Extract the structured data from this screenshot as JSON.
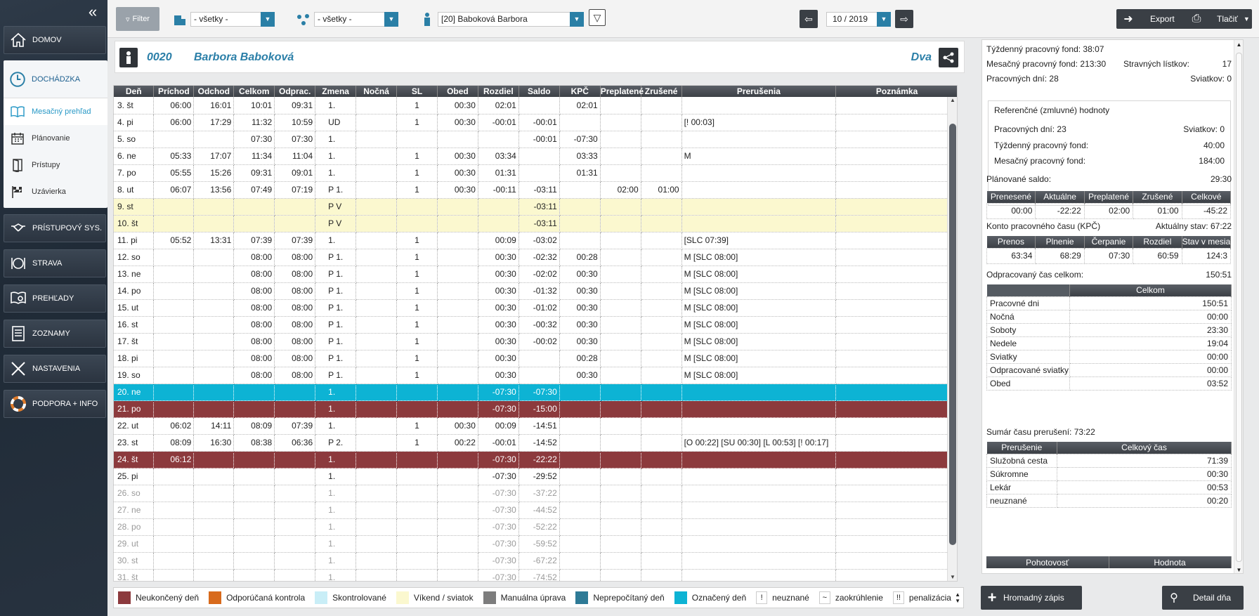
{
  "sidebar": {
    "collapse_icon": "double-chevron-left-icon",
    "items": [
      {
        "label": "DOMOV",
        "icon": "home-icon"
      },
      {
        "label": "DOCHÁDZKA",
        "icon": "clock-icon"
      },
      {
        "label": "PRÍSTUPOVÝ SYS.",
        "icon": "handshake-icon"
      },
      {
        "label": "STRAVA",
        "icon": "plate-icon"
      },
      {
        "label": "PREHĽADY",
        "icon": "report-icon"
      },
      {
        "label": "ZOZNAMY",
        "icon": "list-icon"
      },
      {
        "label": "NASTAVENIA",
        "icon": "tools-icon"
      },
      {
        "label": "PODPORA + INFO",
        "icon": "lifebuoy-icon"
      }
    ],
    "sub_items": [
      {
        "label": "Mesačný prehľad",
        "icon": "book-icon"
      },
      {
        "label": "Plánovanie",
        "icon": "calendar-icon"
      },
      {
        "label": "Prístupy",
        "icon": "door-icon"
      },
      {
        "label": "Uzávierka",
        "icon": "checkered-flag-icon"
      }
    ]
  },
  "toolbar": {
    "filter_label": "Filter",
    "org_select": "- všetky -",
    "group_select": "- všetky -",
    "person_select": "[20] Baboková Barbora",
    "period": "10 / 2019",
    "export_label": "Export",
    "print_label": "Tlačiť"
  },
  "person": {
    "code": "0020",
    "name": "Barbora Baboková",
    "group": "Dva"
  },
  "table": {
    "columns": [
      "Deň",
      "Príchod",
      "Odchod",
      "Celkom",
      "Odprac.",
      "Zmena",
      "Nočná",
      "SL",
      "Obed",
      "Rozdiel",
      "Saldo",
      "KPČ",
      "Preplatené",
      "Zrušené",
      "Prerušenia",
      "Poznámka"
    ],
    "rows": [
      {
        "t": "",
        "c": [
          "3. št",
          "06:00",
          "16:01",
          "10:01",
          "09:31",
          "1.",
          "",
          "1",
          "00:30",
          "02:01",
          "",
          "02:01",
          "",
          "",
          "",
          ""
        ]
      },
      {
        "t": "",
        "c": [
          "4. pi",
          "06:00",
          "17:29",
          "11:32",
          "10:59",
          "UD",
          "",
          "1",
          "00:30",
          "-00:01",
          "-00:01",
          "",
          "",
          "",
          "[! 00:03]",
          ""
        ]
      },
      {
        "t": "",
        "c": [
          "5. so",
          "",
          "",
          "07:30",
          "07:30",
          "1.",
          "",
          "",
          "",
          "",
          "-00:01",
          "-07:30",
          "",
          "",
          "",
          ""
        ]
      },
      {
        "t": "",
        "c": [
          "6. ne",
          "05:33",
          "17:07",
          "11:34",
          "11:04",
          "1.",
          "",
          "1",
          "00:30",
          "03:34",
          "",
          "03:33",
          "",
          "",
          "M",
          ""
        ]
      },
      {
        "t": "",
        "c": [
          "7. po",
          "05:55",
          "15:26",
          "09:31",
          "09:01",
          "1.",
          "",
          "1",
          "00:30",
          "01:31",
          "",
          "01:31",
          "",
          "",
          "",
          ""
        ]
      },
      {
        "t": "",
        "c": [
          "8. ut",
          "06:07",
          "13:56",
          "07:49",
          "07:19",
          "P 1.",
          "",
          "1",
          "00:30",
          "-00:11",
          "-03:11",
          "",
          "02:00",
          "01:00",
          "",
          ""
        ]
      },
      {
        "t": "weekend",
        "c": [
          "9. st",
          "",
          "",
          "",
          "",
          "P V",
          "",
          "",
          "",
          "",
          "-03:11",
          "",
          "",
          "",
          "",
          ""
        ]
      },
      {
        "t": "weekend",
        "c": [
          "10. št",
          "",
          "",
          "",
          "",
          "P V",
          "",
          "",
          "",
          "",
          "-03:11",
          "",
          "",
          "",
          "",
          ""
        ]
      },
      {
        "t": "",
        "c": [
          "11. pi",
          "05:52",
          "13:31",
          "07:39",
          "07:39",
          "1.",
          "",
          "1",
          "",
          "00:09",
          "-03:02",
          "",
          "",
          "",
          "[SLC 07:39]",
          ""
        ]
      },
      {
        "t": "",
        "c": [
          "12. so",
          "",
          "",
          "08:00",
          "08:00",
          "P 1.",
          "",
          "1",
          "",
          "00:30",
          "-02:32",
          "00:28",
          "",
          "",
          "M [SLC 08:00]",
          ""
        ]
      },
      {
        "t": "",
        "c": [
          "13. ne",
          "",
          "",
          "08:00",
          "08:00",
          "P 1.",
          "",
          "1",
          "",
          "00:30",
          "-02:02",
          "00:30",
          "",
          "",
          "M [SLC 08:00]",
          ""
        ]
      },
      {
        "t": "",
        "c": [
          "14. po",
          "",
          "",
          "08:00",
          "08:00",
          "P 1.",
          "",
          "1",
          "",
          "00:30",
          "-01:32",
          "00:30",
          "",
          "",
          "M [SLC 08:00]",
          ""
        ]
      },
      {
        "t": "",
        "c": [
          "15. ut",
          "",
          "",
          "08:00",
          "08:00",
          "P 1.",
          "",
          "1",
          "",
          "00:30",
          "-01:02",
          "00:30",
          "",
          "",
          "M [SLC 08:00]",
          ""
        ]
      },
      {
        "t": "",
        "c": [
          "16. st",
          "",
          "",
          "08:00",
          "08:00",
          "P 1.",
          "",
          "1",
          "",
          "00:30",
          "-00:32",
          "00:30",
          "",
          "",
          "M [SLC 08:00]",
          ""
        ]
      },
      {
        "t": "",
        "c": [
          "17. št",
          "",
          "",
          "08:00",
          "08:00",
          "P 1.",
          "",
          "1",
          "",
          "00:30",
          "-00:02",
          "00:30",
          "",
          "",
          "M [SLC 08:00]",
          ""
        ]
      },
      {
        "t": "",
        "c": [
          "18. pi",
          "",
          "",
          "08:00",
          "08:00",
          "P 1.",
          "",
          "1",
          "",
          "00:30",
          "",
          "00:28",
          "",
          "",
          "M [SLC 08:00]",
          ""
        ]
      },
      {
        "t": "",
        "c": [
          "19. so",
          "",
          "",
          "08:00",
          "08:00",
          "P 1.",
          "",
          "1",
          "",
          "00:30",
          "",
          "00:30",
          "",
          "",
          "M [SLC 08:00]",
          ""
        ]
      },
      {
        "t": "marked",
        "c": [
          "20. ne",
          "",
          "",
          "",
          "",
          "1.",
          "",
          "",
          "",
          "-07:30",
          "-07:30",
          "",
          "",
          "",
          "",
          ""
        ]
      },
      {
        "t": "unfinished",
        "c": [
          "21. po",
          "",
          "",
          "",
          "",
          "1.",
          "",
          "",
          "",
          "-07:30",
          "-15:00",
          "",
          "",
          "",
          "",
          ""
        ]
      },
      {
        "t": "",
        "c": [
          "22. ut",
          "06:02",
          "14:11",
          "08:09",
          "07:39",
          "1.",
          "",
          "1",
          "00:30",
          "00:09",
          "-14:51",
          "",
          "",
          "",
          "",
          ""
        ]
      },
      {
        "t": "",
        "c": [
          "23. st",
          "08:09",
          "16:30",
          "08:38",
          "06:36",
          "P 2.",
          "",
          "1",
          "00:22",
          "-00:01",
          "-14:52",
          "",
          "",
          "",
          "[O 00:22] [SU 00:30] [L 00:53] [! 00:17]",
          ""
        ]
      },
      {
        "t": "unfinished",
        "c": [
          "24. št",
          "06:12",
          "",
          "",
          "",
          "1.",
          "",
          "",
          "",
          "-07:30",
          "-22:22",
          "",
          "",
          "",
          "",
          ""
        ]
      },
      {
        "t": "",
        "c": [
          "25. pi",
          "",
          "",
          "",
          "",
          "1.",
          "",
          "",
          "",
          "-07:30",
          "-29:52",
          "",
          "",
          "",
          "",
          ""
        ]
      },
      {
        "t": "future",
        "c": [
          "26. so",
          "",
          "",
          "",
          "",
          "1.",
          "",
          "",
          "",
          "-07:30",
          "-37:22",
          "",
          "",
          "",
          "",
          ""
        ]
      },
      {
        "t": "future",
        "c": [
          "27. ne",
          "",
          "",
          "",
          "",
          "1.",
          "",
          "",
          "",
          "-07:30",
          "-44:52",
          "",
          "",
          "",
          "",
          ""
        ]
      },
      {
        "t": "future",
        "c": [
          "28. po",
          "",
          "",
          "",
          "",
          "1.",
          "",
          "",
          "",
          "-07:30",
          "-52:22",
          "",
          "",
          "",
          "",
          ""
        ]
      },
      {
        "t": "future",
        "c": [
          "29. ut",
          "",
          "",
          "",
          "",
          "1.",
          "",
          "",
          "",
          "-07:30",
          "-59:52",
          "",
          "",
          "",
          "",
          ""
        ]
      },
      {
        "t": "future",
        "c": [
          "30. st",
          "",
          "",
          "",
          "",
          "1.",
          "",
          "",
          "",
          "-07:30",
          "-67:22",
          "",
          "",
          "",
          "",
          ""
        ]
      },
      {
        "t": "future",
        "c": [
          "31. št",
          "",
          "",
          "",
          "",
          "1.",
          "",
          "",
          "",
          "-07:30",
          "-74:52",
          "",
          "",
          "",
          "",
          ""
        ]
      }
    ]
  },
  "legend": [
    {
      "label": "Neukončený deň",
      "color": "#8c3a3d"
    },
    {
      "label": "Odporúčaná kontrola",
      "color": "#d86a1c"
    },
    {
      "label": "Skontrolované",
      "color": "#c9eef7"
    },
    {
      "label": "Víkend / sviatok",
      "color": "#fbf8cf"
    },
    {
      "label": "Manuálna úprava",
      "color": "#7d7d7d"
    },
    {
      "label": "Neprepočítaný deň",
      "color": "#2e7a96"
    },
    {
      "label": "Označený deň",
      "color": "#0db3d4"
    }
  ],
  "legend_symbols": [
    {
      "sym": "!",
      "label": "neuznané"
    },
    {
      "sym": "~",
      "label": "zaokrúhlenie"
    },
    {
      "sym": "!!",
      "label": "penalizácia"
    }
  ],
  "summary": {
    "weekly_fund_label": "Týždenný pracovný fond:",
    "weekly_fund": "38:07",
    "monthly_fund_label": "Mesačný pracovný fond:",
    "monthly_fund": "213:30",
    "meal_label": "Stravných lístkov:",
    "meal": "17",
    "workdays_label": "Pracovných dní:",
    "workdays": "28",
    "holidays_label": "Sviatkov:",
    "holidays": "0",
    "ref_title": "Referenčné (zmluvné) hodnoty",
    "ref_workdays_label": "Pracovných dní:",
    "ref_workdays": "23",
    "ref_holidays_label": "Sviatkov:",
    "ref_holidays": "0",
    "ref_weekly_label": "Týždenný pracovný fond:",
    "ref_weekly": "40:00",
    "ref_monthly_label": "Mesačný pracovný fond:",
    "ref_monthly": "184:00",
    "planned_label": "Plánované saldo:",
    "planned": "29:30",
    "saldo_headers": [
      "Prenesené",
      "Aktuálne",
      "Preplatené",
      "Zrušené",
      "Celkové"
    ],
    "saldo_values": [
      "00:00",
      "-22:22",
      "02:00",
      "01:00",
      "-45:22"
    ],
    "kpc_label": "Konto pracovného času (KPČ)",
    "kpc_state_label": "Aktuálny stav:",
    "kpc_state": "67:22",
    "kpc_headers": [
      "Prenos",
      "Plnenie",
      "Čerpanie",
      "Rozdiel",
      "Stav v mesiac"
    ],
    "kpc_values": [
      "63:34",
      "68:29",
      "07:30",
      "60:59",
      "124:3"
    ],
    "worked_label": "Odpracovaný čas celkom:",
    "worked": "150:51",
    "worked_header": "Celkom",
    "worked_rows": [
      {
        "label": "Pracovné dni",
        "value": "150:51"
      },
      {
        "label": "Nočná",
        "value": "00:00"
      },
      {
        "label": "Soboty",
        "value": "23:30"
      },
      {
        "label": "Nedele",
        "value": "19:04"
      },
      {
        "label": "Sviatky",
        "value": "00:00"
      },
      {
        "label": "Odpracované sviatky",
        "value": "00:00"
      },
      {
        "label": "Obed",
        "value": "03:52"
      }
    ],
    "interrupt_label": "Sumár času prerušení:",
    "interrupt": "73:22",
    "interrupt_headers": [
      "Prerušenie",
      "Celkový čas"
    ],
    "interrupt_rows": [
      {
        "label": "Služobná cesta",
        "value": "71:39"
      },
      {
        "label": "Súkromne",
        "value": "00:30"
      },
      {
        "label": "Lekár",
        "value": "00:53"
      },
      {
        "label": "neuznané",
        "value": "00:20"
      }
    ],
    "standby_headers": [
      "Pohotovosť",
      "Hodnota"
    ]
  },
  "actions": {
    "bulk_label": "Hromadný zápis",
    "detail_label": "Detail dňa"
  }
}
